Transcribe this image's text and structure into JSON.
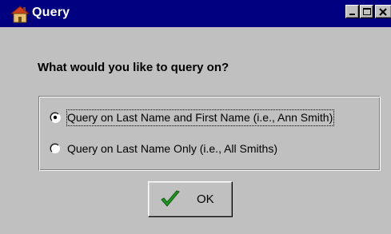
{
  "window": {
    "title": "Query",
    "controls": [
      "minimize-icon",
      "maximize-icon",
      "close-icon"
    ]
  },
  "dialog": {
    "question": "What would you like to query on?",
    "options": [
      {
        "label": "Query on Last Name and First Name  (i.e., Ann Smith)",
        "selected": true
      },
      {
        "label": "Query on Last Name Only  (i.e., All Smiths)",
        "selected": false
      }
    ],
    "ok_label": "OK"
  },
  "colors": {
    "titlebar": "#000080",
    "face": "#c0c0c0",
    "check": "#1f9a1f"
  }
}
